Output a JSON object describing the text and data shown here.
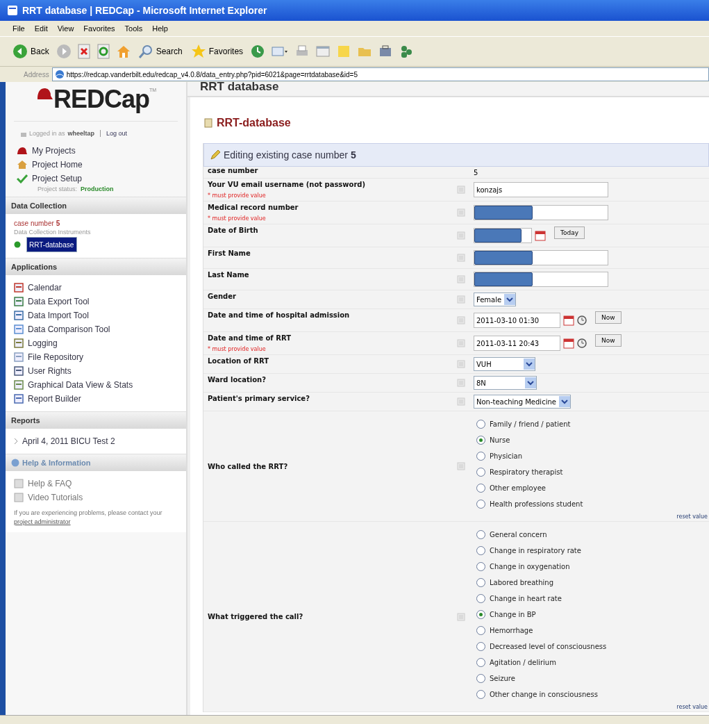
{
  "window": {
    "title": "RRT database | REDCap - Microsoft Internet Explorer"
  },
  "menu": [
    "File",
    "Edit",
    "View",
    "Favorites",
    "Tools",
    "Help"
  ],
  "toolbar": {
    "back": "Back",
    "search": "Search",
    "favorites": "Favorites"
  },
  "address": {
    "label": "Address",
    "url": "https://redcap.vanderbilt.edu/redcap_v4.0.8/data_entry.php?pid=6021&page=rrtdatabase&id=5"
  },
  "sidebar": {
    "logo": "REDCap",
    "logo_mark": "TM",
    "login": {
      "prefix": "Logged in as",
      "user": "wheeltap",
      "logout": "Log out"
    },
    "project_links": [
      "My Projects",
      "Project Home",
      "Project Setup"
    ],
    "status_label": "Project status:",
    "status_value": "Production",
    "data_collection": {
      "heading": "Data Collection",
      "record_label": "case number",
      "record": "5",
      "instruments_label": "Data Collection Instruments",
      "instruments": [
        {
          "label": "RRT-database",
          "selected": true
        }
      ]
    },
    "applications": {
      "heading": "Applications",
      "items": [
        "Calendar",
        "Data Export Tool",
        "Data Import Tool",
        "Data Comparison Tool",
        "Logging",
        "File Repository",
        "User Rights",
        "Graphical Data View & Stats",
        "Report Builder"
      ]
    },
    "reports": {
      "heading": "Reports",
      "items": [
        "April 4, 2011 BICU Test 2"
      ]
    },
    "help": {
      "heading": "Help & Information",
      "items": [
        "Help & FAQ",
        "Video Tutorials"
      ],
      "note": "If you are experiencing problems, please contact your",
      "link": "project administrator"
    }
  },
  "main": {
    "header": "RRT database",
    "form_title": "RRT-database",
    "banner": "Editing existing case number **5**",
    "fields": [
      {
        "kind": "static",
        "label": "case number",
        "value": "5"
      },
      {
        "kind": "text",
        "label": "Your VU email username (not password)",
        "value": "konzajs",
        "required_note": "* must provide value"
      },
      {
        "kind": "text",
        "label": "Medical record number",
        "required_note": "* must provide value",
        "redacted": true
      },
      {
        "kind": "date",
        "label": "Date of Birth",
        "redacted": true,
        "button": "Today"
      },
      {
        "kind": "text",
        "label": "First Name",
        "redacted": true
      },
      {
        "kind": "text",
        "label": "Last Name",
        "redacted": true
      },
      {
        "kind": "select",
        "label": "Gender",
        "value": "Female"
      },
      {
        "kind": "datetime",
        "label": "Date and time of hospital admission",
        "value": "2011-03-10 01:30",
        "button": "Now"
      },
      {
        "kind": "datetime",
        "label": "Date and time of RRT",
        "value": "2011-03-11 20:43",
        "required_note": "* must provide value",
        "button": "Now"
      },
      {
        "kind": "select",
        "label": "Location of RRT",
        "value": "VUH"
      },
      {
        "kind": "select",
        "label": "Ward location?",
        "value": "8N"
      },
      {
        "kind": "select",
        "label": "Patient's primary service?",
        "value": "Non-teaching Medicine"
      },
      {
        "kind": "radio",
        "label": "Who called the RRT?",
        "reset": "reset value",
        "options": [
          {
            "label": "Family / friend / patient",
            "selected": false
          },
          {
            "label": "Nurse",
            "selected": true
          },
          {
            "label": "Physician",
            "selected": false
          },
          {
            "label": "Respiratory therapist",
            "selected": false
          },
          {
            "label": "Other employee",
            "selected": false
          },
          {
            "label": "Health professions student",
            "selected": false
          }
        ]
      },
      {
        "kind": "radio",
        "label": "What triggered the call?",
        "reset": "reset value",
        "options": [
          {
            "label": "General concern",
            "selected": false
          },
          {
            "label": "Change in respiratory rate",
            "selected": false
          },
          {
            "label": "Change in oxygenation",
            "selected": false
          },
          {
            "label": "Labored breathing",
            "selected": false
          },
          {
            "label": "Change in heart rate",
            "selected": false
          },
          {
            "label": "Change in BP",
            "selected": true
          },
          {
            "label": "Hemorrhage",
            "selected": false
          },
          {
            "label": "Decreased level of consciousness",
            "selected": false
          },
          {
            "label": "Agitation / delirium",
            "selected": false
          },
          {
            "label": "Seizure",
            "selected": false
          },
          {
            "label": "Other change in consciousness",
            "selected": false
          }
        ]
      }
    ]
  }
}
